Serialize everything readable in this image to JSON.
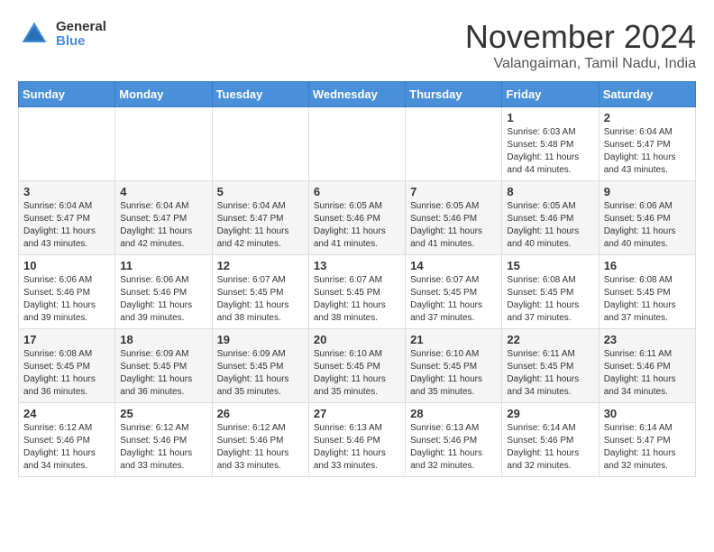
{
  "logo": {
    "general": "General",
    "blue": "Blue"
  },
  "header": {
    "month": "November 2024",
    "location": "Valangaiman, Tamil Nadu, India"
  },
  "weekdays": [
    "Sunday",
    "Monday",
    "Tuesday",
    "Wednesday",
    "Thursday",
    "Friday",
    "Saturday"
  ],
  "weeks": [
    [
      {
        "day": "",
        "info": ""
      },
      {
        "day": "",
        "info": ""
      },
      {
        "day": "",
        "info": ""
      },
      {
        "day": "",
        "info": ""
      },
      {
        "day": "",
        "info": ""
      },
      {
        "day": "1",
        "info": "Sunrise: 6:03 AM\nSunset: 5:48 PM\nDaylight: 11 hours and 44 minutes."
      },
      {
        "day": "2",
        "info": "Sunrise: 6:04 AM\nSunset: 5:47 PM\nDaylight: 11 hours and 43 minutes."
      }
    ],
    [
      {
        "day": "3",
        "info": "Sunrise: 6:04 AM\nSunset: 5:47 PM\nDaylight: 11 hours and 43 minutes."
      },
      {
        "day": "4",
        "info": "Sunrise: 6:04 AM\nSunset: 5:47 PM\nDaylight: 11 hours and 42 minutes."
      },
      {
        "day": "5",
        "info": "Sunrise: 6:04 AM\nSunset: 5:47 PM\nDaylight: 11 hours and 42 minutes."
      },
      {
        "day": "6",
        "info": "Sunrise: 6:05 AM\nSunset: 5:46 PM\nDaylight: 11 hours and 41 minutes."
      },
      {
        "day": "7",
        "info": "Sunrise: 6:05 AM\nSunset: 5:46 PM\nDaylight: 11 hours and 41 minutes."
      },
      {
        "day": "8",
        "info": "Sunrise: 6:05 AM\nSunset: 5:46 PM\nDaylight: 11 hours and 40 minutes."
      },
      {
        "day": "9",
        "info": "Sunrise: 6:06 AM\nSunset: 5:46 PM\nDaylight: 11 hours and 40 minutes."
      }
    ],
    [
      {
        "day": "10",
        "info": "Sunrise: 6:06 AM\nSunset: 5:46 PM\nDaylight: 11 hours and 39 minutes."
      },
      {
        "day": "11",
        "info": "Sunrise: 6:06 AM\nSunset: 5:46 PM\nDaylight: 11 hours and 39 minutes."
      },
      {
        "day": "12",
        "info": "Sunrise: 6:07 AM\nSunset: 5:45 PM\nDaylight: 11 hours and 38 minutes."
      },
      {
        "day": "13",
        "info": "Sunrise: 6:07 AM\nSunset: 5:45 PM\nDaylight: 11 hours and 38 minutes."
      },
      {
        "day": "14",
        "info": "Sunrise: 6:07 AM\nSunset: 5:45 PM\nDaylight: 11 hours and 37 minutes."
      },
      {
        "day": "15",
        "info": "Sunrise: 6:08 AM\nSunset: 5:45 PM\nDaylight: 11 hours and 37 minutes."
      },
      {
        "day": "16",
        "info": "Sunrise: 6:08 AM\nSunset: 5:45 PM\nDaylight: 11 hours and 37 minutes."
      }
    ],
    [
      {
        "day": "17",
        "info": "Sunrise: 6:08 AM\nSunset: 5:45 PM\nDaylight: 11 hours and 36 minutes."
      },
      {
        "day": "18",
        "info": "Sunrise: 6:09 AM\nSunset: 5:45 PM\nDaylight: 11 hours and 36 minutes."
      },
      {
        "day": "19",
        "info": "Sunrise: 6:09 AM\nSunset: 5:45 PM\nDaylight: 11 hours and 35 minutes."
      },
      {
        "day": "20",
        "info": "Sunrise: 6:10 AM\nSunset: 5:45 PM\nDaylight: 11 hours and 35 minutes."
      },
      {
        "day": "21",
        "info": "Sunrise: 6:10 AM\nSunset: 5:45 PM\nDaylight: 11 hours and 35 minutes."
      },
      {
        "day": "22",
        "info": "Sunrise: 6:11 AM\nSunset: 5:45 PM\nDaylight: 11 hours and 34 minutes."
      },
      {
        "day": "23",
        "info": "Sunrise: 6:11 AM\nSunset: 5:46 PM\nDaylight: 11 hours and 34 minutes."
      }
    ],
    [
      {
        "day": "24",
        "info": "Sunrise: 6:12 AM\nSunset: 5:46 PM\nDaylight: 11 hours and 34 minutes."
      },
      {
        "day": "25",
        "info": "Sunrise: 6:12 AM\nSunset: 5:46 PM\nDaylight: 11 hours and 33 minutes."
      },
      {
        "day": "26",
        "info": "Sunrise: 6:12 AM\nSunset: 5:46 PM\nDaylight: 11 hours and 33 minutes."
      },
      {
        "day": "27",
        "info": "Sunrise: 6:13 AM\nSunset: 5:46 PM\nDaylight: 11 hours and 33 minutes."
      },
      {
        "day": "28",
        "info": "Sunrise: 6:13 AM\nSunset: 5:46 PM\nDaylight: 11 hours and 32 minutes."
      },
      {
        "day": "29",
        "info": "Sunrise: 6:14 AM\nSunset: 5:46 PM\nDaylight: 11 hours and 32 minutes."
      },
      {
        "day": "30",
        "info": "Sunrise: 6:14 AM\nSunset: 5:47 PM\nDaylight: 11 hours and 32 minutes."
      }
    ]
  ]
}
